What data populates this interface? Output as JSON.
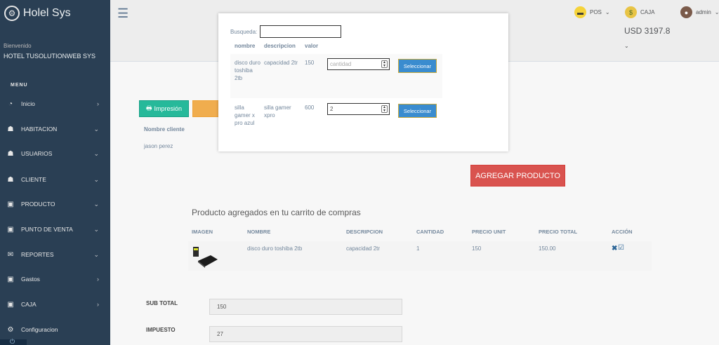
{
  "app": {
    "title": "Holel Sys"
  },
  "sidebar": {
    "welcome": "Bienvenido",
    "user": "HOTEL TUSOLUTIONWEB SYS",
    "menu_header": "MENU",
    "items": [
      {
        "label": "Inicio",
        "icon": "dashboard-icon"
      },
      {
        "label": "HABITACION",
        "icon": "user-icon"
      },
      {
        "label": "USUARIOS",
        "icon": "user-icon"
      },
      {
        "label": "CLIENTE",
        "icon": "user-icon"
      },
      {
        "label": "PRODUCTO",
        "icon": "money-icon"
      },
      {
        "label": "PUNTO DE VENTA",
        "icon": "money-icon"
      },
      {
        "label": "REPORTES",
        "icon": "envelope-icon"
      },
      {
        "label": "Gastos",
        "icon": "money-icon"
      },
      {
        "label": "CAJA",
        "icon": "money-icon"
      },
      {
        "label": "Configuracion",
        "icon": "gear-icon"
      }
    ]
  },
  "topbar": {
    "pos_label": "POS",
    "caja_label": "CAJA",
    "admin_label": "admin",
    "balance": "USD 3197.8"
  },
  "content": {
    "print_label": "Impresión",
    "client_header": "Nombre cliente",
    "client_name": "jason perez",
    "add_product_label": "AGREGAR PRODUCTO",
    "cart_title": "Producto agregados en tu carrito de compras",
    "cart_headers": [
      "IMAGEN",
      "NOMBRE",
      "DESCRIPCION",
      "CANTIDAD",
      "PRECIO UNIT",
      "PRECIO TOTAL",
      "ACCIÓN"
    ],
    "cart_rows": [
      {
        "nombre": "disco duro toshiba 2tb",
        "descripcion": "capacidad 2tr",
        "cantidad": "1",
        "precio_unit": "150",
        "precio_total": "150.00"
      }
    ],
    "subtotal_label": "SUB TOTAL",
    "subtotal_value": "150",
    "impuesto_label": "IMPUESTO",
    "impuesto_value": "27"
  },
  "modal": {
    "search_label": "Busqueda:",
    "search_value": "",
    "headers": [
      "nombre",
      "descripcion",
      "valor"
    ],
    "rows": [
      {
        "nombre": "disco duro toshiba 2tb",
        "descripcion": "capacidad 2tr",
        "valor": "150",
        "cantidad_placeholder": "cantidad",
        "cantidad": "",
        "button": "Seleccionar"
      },
      {
        "nombre": "silla gamer x pro azul",
        "descripcion": "silla gamer xpro",
        "valor": "600",
        "cantidad_placeholder": "",
        "cantidad": "2",
        "button": "Seleccionar"
      }
    ]
  },
  "colors": {
    "sidebar_bg": "#2a3f54",
    "print_button": "#26b99a",
    "add_product_button": "#d9534f",
    "select_button": "#3a8ccf"
  }
}
